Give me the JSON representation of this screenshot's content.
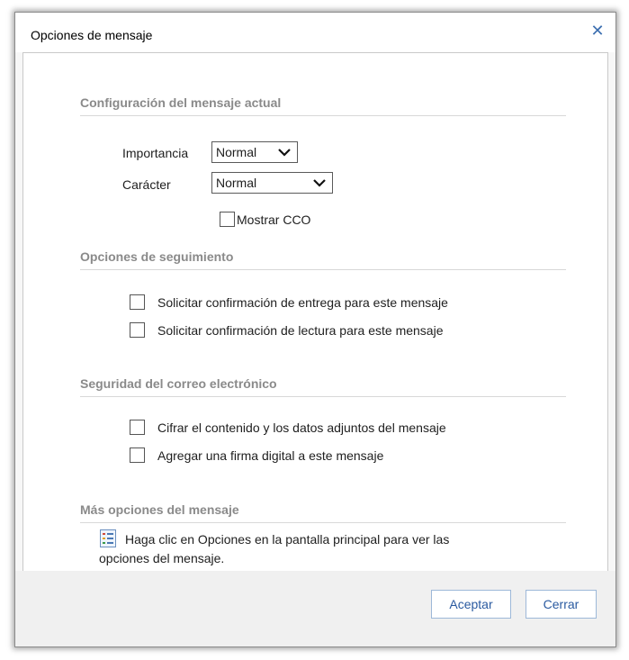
{
  "dialog": {
    "title": "Opciones de mensaje",
    "close_icon": "close-icon"
  },
  "current": {
    "heading": "Configuración del mensaje actual",
    "importance_label": "Importancia",
    "importance_value": "Normal",
    "sensitivity_label": "Carácter",
    "sensitivity_value": "Normal",
    "bcc_label": "Mostrar CCO",
    "bcc_checked": false
  },
  "tracking": {
    "heading": "Opciones de seguimiento",
    "delivery_label": "Solicitar confirmación de entrega para este mensaje",
    "delivery_checked": false,
    "read_label": "Solicitar confirmación de lectura para este mensaje",
    "read_checked": false
  },
  "security": {
    "heading": "Seguridad del correo electrónico",
    "encrypt_label": "Cifrar el contenido y los datos adjuntos del mensaje",
    "encrypt_checked": false,
    "sign_label": "Agregar una firma digital a este mensaje",
    "sign_checked": false
  },
  "more": {
    "heading": "Más opciones del mensaje",
    "info_icon": "options-list-icon",
    "info_line1": "Haga clic en Opciones en la pantalla principal para ver las",
    "info_line2": "opciones del mensaje."
  },
  "buttons": {
    "accept_label": "Aceptar",
    "close_label": "Cerrar"
  }
}
